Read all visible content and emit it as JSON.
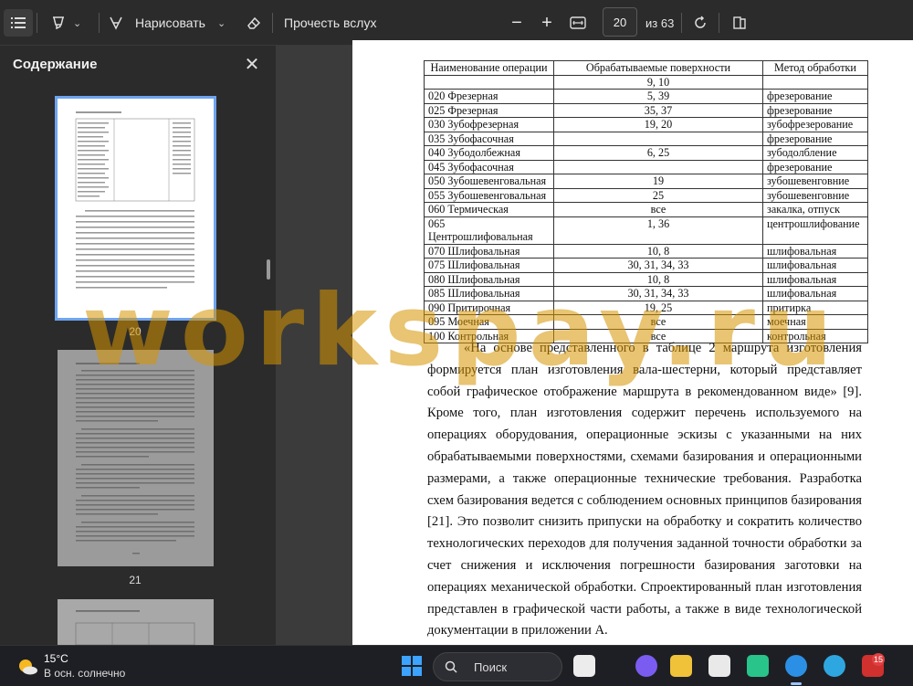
{
  "toolbar": {
    "draw_label": "Нарисовать",
    "read_aloud_label": "Прочесть вслух",
    "page_number": "20",
    "page_total": "из 63"
  },
  "sidebar": {
    "title": "Содержание",
    "thumbnails": [
      {
        "page": "20"
      },
      {
        "page": "21"
      }
    ]
  },
  "document": {
    "table_headers": [
      "Наименование операции",
      "Обрабатываемые поверхности",
      "Метод обработки"
    ],
    "table_rows": [
      [
        "",
        "9, 10",
        ""
      ],
      [
        "020 Фрезерная",
        "5, 39",
        "фрезерование"
      ],
      [
        "025 Фрезерная",
        "35, 37",
        "фрезерование"
      ],
      [
        "030 Зубофрезерная",
        "19, 20",
        "зубофрезерование"
      ],
      [
        "035 Зубофасочная",
        "",
        "фрезерование"
      ],
      [
        "040 Зубодолбежная",
        "6, 25",
        "зубодолбление"
      ],
      [
        "045 Зубофасочная",
        "",
        "фрезерование"
      ],
      [
        "050 Зубошевенговальная",
        "19",
        "зубошевенговние"
      ],
      [
        "055 Зубошевенговальная",
        "25",
        "зубошевенговние"
      ],
      [
        "060 Термическая",
        "все",
        "закалка, отпуск"
      ],
      [
        "065 Центрошлифовальная",
        "1, 36",
        "центрошлифование"
      ],
      [
        "070 Шлифовальная",
        "10, 8",
        "шлифовальная"
      ],
      [
        "075 Шлифовальная",
        "30, 31, 34, 33",
        "шлифовальная"
      ],
      [
        "080 Шлифовальная",
        "10, 8",
        "шлифовальная"
      ],
      [
        "085 Шлифовальная",
        "30, 31, 34, 33",
        "шлифовальная"
      ],
      [
        "090 Притирочная",
        "19, 25",
        "притирка"
      ],
      [
        "095 Моечная",
        "все",
        "моечная"
      ],
      [
        "100 Контрольная",
        "все",
        "контрольная"
      ]
    ],
    "paragraph": "«На основе представленного в таблице 2 маршрута изготовления формируется план изготовления вала-шестерни, который представляет собой графическое отображение маршрута в рекомендованном виде» [9]. Кроме того, план изготовления содержит перечень используемого на операциях оборудования, операционные эскизы с указанными на них обрабатываемыми поверхностями, схемами базирования и операционными размерами, а также операционные технические требования. Разработка схем базирования ведется с соблюдением основных принципов базирования [21]. Это позволит снизить припуски на обработку и сократить количество технологических переходов для получения заданной точности обработки за счет снижения и исключения погрешности базирования заготовки на операциях механической обработки. Спроектированный план изготовления представлен в графической части работы, а также в виде технологической документации в приложении А."
  },
  "watermark": "workspay.ru",
  "taskbar": {
    "temperature": "15°C",
    "weather_desc": "В осн. солнечно",
    "search_label": "Поиск",
    "telegram_badge": "15"
  },
  "colors": {
    "accent": "#6ea4f0",
    "watermark": "#d69400"
  }
}
